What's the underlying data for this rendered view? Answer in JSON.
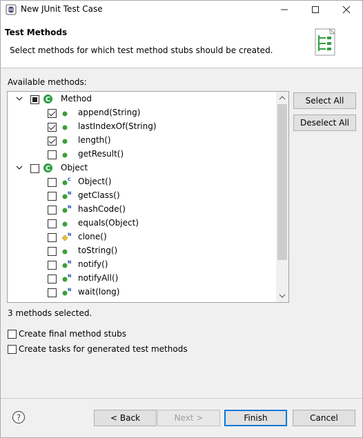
{
  "window": {
    "title": "New JUnit Test Case",
    "minimize_glyph": "—",
    "maximize_glyph": "☐",
    "close_glyph": "✕"
  },
  "header": {
    "title": "Test Methods",
    "description": "Select methods for which test method stubs should be created."
  },
  "tree": {
    "label": "Available methods:",
    "items": [
      {
        "label": "Method",
        "kind": "class",
        "level": 0,
        "expanded": true,
        "check": "partial"
      },
      {
        "label": "append(String)",
        "kind": "method",
        "level": 1,
        "check": "checked",
        "icon": "public-method-icon",
        "overlay": ""
      },
      {
        "label": "lastIndexOf(String)",
        "kind": "method",
        "level": 1,
        "check": "checked",
        "icon": "public-method-icon",
        "overlay": ""
      },
      {
        "label": "length()",
        "kind": "method",
        "level": 1,
        "check": "checked",
        "icon": "public-method-icon",
        "overlay": ""
      },
      {
        "label": "getResult()",
        "kind": "method",
        "level": 1,
        "check": "unchecked",
        "icon": "public-method-icon",
        "overlay": ""
      },
      {
        "label": "Object",
        "kind": "class",
        "level": 0,
        "expanded": true,
        "check": "unchecked"
      },
      {
        "label": "Object()",
        "kind": "method",
        "level": 1,
        "check": "unchecked",
        "icon": "constructor-icon",
        "overlay": "C"
      },
      {
        "label": "getClass()",
        "kind": "method",
        "level": 1,
        "check": "unchecked",
        "icon": "native-final-method-icon",
        "overlay": "NF"
      },
      {
        "label": "hashCode()",
        "kind": "method",
        "level": 1,
        "check": "unchecked",
        "icon": "native-method-icon",
        "overlay": "N"
      },
      {
        "label": "equals(Object)",
        "kind": "method",
        "level": 1,
        "check": "unchecked",
        "icon": "public-method-icon",
        "overlay": ""
      },
      {
        "label": "clone()",
        "kind": "method",
        "level": 1,
        "check": "unchecked",
        "icon": "protected-native-method-icon",
        "overlay": "N"
      },
      {
        "label": "toString()",
        "kind": "method",
        "level": 1,
        "check": "unchecked",
        "icon": "public-method-icon",
        "overlay": ""
      },
      {
        "label": "notify()",
        "kind": "method",
        "level": 1,
        "check": "unchecked",
        "icon": "native-final-method-icon",
        "overlay": "NF"
      },
      {
        "label": "notifyAll()",
        "kind": "method",
        "level": 1,
        "check": "unchecked",
        "icon": "native-final-method-icon",
        "overlay": "NF"
      },
      {
        "label": "wait(long)",
        "kind": "method",
        "level": 1,
        "check": "unchecked",
        "icon": "native-final-method-icon",
        "overlay": "NF"
      }
    ]
  },
  "side_buttons": {
    "select_all": "Select All",
    "deselect_all": "Deselect All"
  },
  "status": "3 methods selected.",
  "options": {
    "final_stubs": {
      "label": "Create final method stubs",
      "checked": false
    },
    "create_tasks": {
      "label": "Create tasks for generated test methods",
      "checked": false
    }
  },
  "footer": {
    "back": "< Back",
    "next": "Next >",
    "finish": "Finish",
    "cancel": "Cancel"
  },
  "colors": {
    "method_green": "#3c9e3c",
    "class_green": "#2e9e46",
    "protected_yellow": "#e8c23a",
    "overlay_blue": "#1a4ea8",
    "default_button_border": "#0078d7"
  }
}
